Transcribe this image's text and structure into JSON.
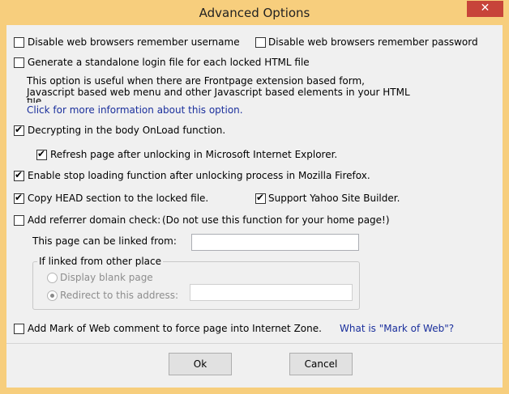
{
  "window": {
    "title": "Advanced Options",
    "close_glyph": "✕",
    "accent_color": "#f7ce7d",
    "close_color": "#c7443a"
  },
  "options": {
    "disable_username": {
      "label": "Disable web browsers remember username",
      "checked": false
    },
    "disable_password": {
      "label": "Disable web browsers remember password",
      "checked": false
    },
    "standalone_login": {
      "label": "Generate a standalone login file for each locked HTML file",
      "checked": false
    },
    "standalone_desc_line1": "This option is useful when there are Frontpage extension based form,",
    "standalone_desc_line2": "Javascript based web menu and other Javascript based elements in your HTML",
    "standalone_desc_line3": "file.",
    "more_info_link": "Click for more information about this option.",
    "decrypt_onload": {
      "label": "Decrypting in the body OnLoad function.",
      "checked": true
    },
    "refresh_ie": {
      "label": "Refresh page after unlocking in Microsoft Internet Explorer.",
      "checked": true
    },
    "stop_loading_firefox": {
      "label": "Enable stop loading function after unlocking process in Mozilla Firefox.",
      "checked": true
    },
    "copy_head": {
      "label": "Copy HEAD section to the locked file.",
      "checked": true
    },
    "support_yahoo": {
      "label": "Support Yahoo Site Builder.",
      "checked": true
    },
    "referrer_check": {
      "label": "Add referrer domain check:",
      "checked": false
    },
    "referrer_note": "(Do not use this function for your home page!)",
    "linked_from_label": "This page can be linked from:",
    "linked_from_value": "",
    "group_title": "If linked from other place",
    "display_blank": {
      "label": "Display blank page",
      "selected": false
    },
    "redirect": {
      "label": "Redirect to this address:",
      "selected": true,
      "value": ""
    },
    "mark_of_web": {
      "label": "Add Mark of Web comment to force page into Internet Zone.",
      "checked": false
    },
    "mark_of_web_link": "What is \"Mark of Web\"?"
  },
  "buttons": {
    "ok": "Ok",
    "cancel": "Cancel"
  }
}
